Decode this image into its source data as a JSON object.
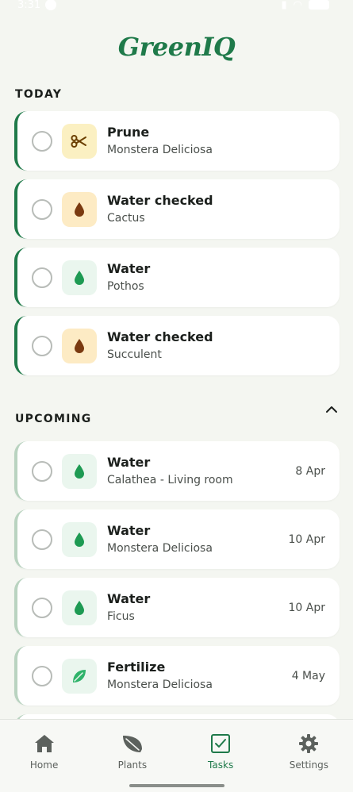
{
  "status_bar": {
    "time": "3:31"
  },
  "app": {
    "logo": "GreenIQ"
  },
  "sections": {
    "today": "TODAY",
    "upcoming": "UPCOMING"
  },
  "today_tasks": [
    {
      "title": "Prune",
      "plant": "Monstera Deliciosa",
      "icon": "scissors-icon",
      "icon_bg": "yellow"
    },
    {
      "title": "Water checked",
      "plant": "Cactus",
      "icon": "water-drop-icon",
      "icon_bg": "amber"
    },
    {
      "title": "Water",
      "plant": "Pothos",
      "icon": "water-drop-icon",
      "icon_bg": "mint"
    },
    {
      "title": "Water checked",
      "plant": "Succulent",
      "icon": "water-drop-icon",
      "icon_bg": "amber"
    }
  ],
  "upcoming_tasks": [
    {
      "title": "Water",
      "plant": "Calathea - Living room",
      "date": "8 Apr",
      "icon": "water-drop-icon"
    },
    {
      "title": "Water",
      "plant": "Monstera Deliciosa",
      "date": "10 Apr",
      "icon": "water-drop-icon"
    },
    {
      "title": "Water",
      "plant": "Ficus",
      "date": "10 Apr",
      "icon": "water-drop-icon"
    },
    {
      "title": "Fertilize",
      "plant": "Monstera Deliciosa",
      "date": "4 May",
      "icon": "leaf-icon"
    }
  ],
  "nav": {
    "items": [
      {
        "label": "Home",
        "icon": "home-icon"
      },
      {
        "label": "Plants",
        "icon": "leaf-icon"
      },
      {
        "label": "Tasks",
        "icon": "tasks-checkbox-icon",
        "active": true
      },
      {
        "label": "Settings",
        "icon": "gear-icon"
      }
    ]
  },
  "colors": {
    "accent": "#1f7a4a",
    "background": "#f4f6f1",
    "today_bar": "#1f7a4a",
    "upcoming_bar": "#b9d3c0",
    "water_drop_green": "#1e9a53",
    "water_drop_brown": "#7a3a10"
  }
}
